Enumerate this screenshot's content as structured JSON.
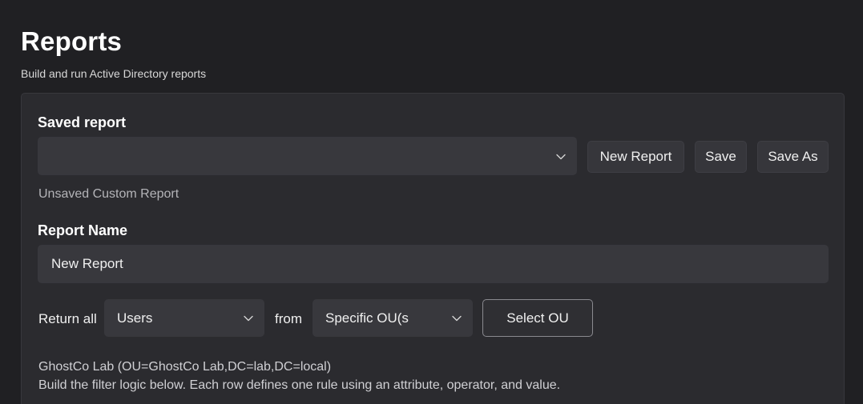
{
  "header": {
    "title": "Reports",
    "subtitle": "Build and run Active Directory reports"
  },
  "saved_report": {
    "label": "Saved report",
    "selected_value": "",
    "status": "Unsaved Custom Report",
    "buttons": {
      "new_report": "New Report",
      "save": "Save",
      "save_as": "Save As"
    }
  },
  "report_name": {
    "label": "Report Name",
    "value": "New Report"
  },
  "query": {
    "return_all_label": "Return all",
    "object_type": "Users",
    "from_label": "from",
    "scope": "Specific OU(s",
    "select_ou_button": "Select OU"
  },
  "info": {
    "selected_ou": "GhostCo Lab (OU=GhostCo Lab,DC=lab,DC=local)",
    "help_text": "Build the filter logic below. Each row defines one rule using an attribute, operator, and value."
  },
  "icons": {
    "dropdown": "chevron-down-icon"
  },
  "colors": {
    "background": "#202023",
    "card": "#2b2b2f",
    "input": "#38383d",
    "outline_border": "#8a8a90"
  }
}
